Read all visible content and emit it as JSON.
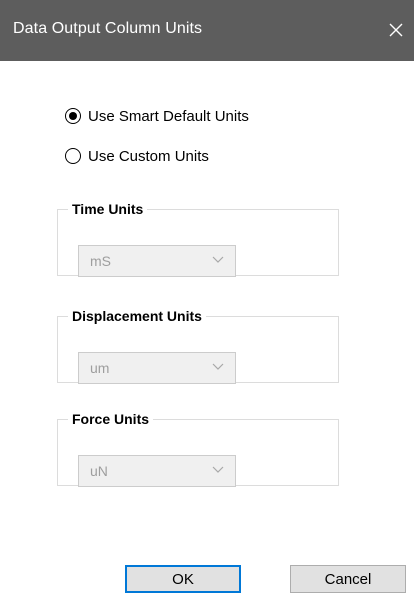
{
  "window": {
    "title": "Data Output Column Units",
    "close_icon": "close-icon"
  },
  "units_mode": {
    "options": [
      {
        "label": "Use Smart Default Units",
        "selected": true
      },
      {
        "label": "Use Custom Units",
        "selected": false
      }
    ]
  },
  "groups": {
    "time": {
      "title": "Time Units",
      "value": "mS",
      "enabled": false
    },
    "displacement": {
      "title": "Displacement Units",
      "value": "um",
      "enabled": false
    },
    "force": {
      "title": "Force Units",
      "value": "uN",
      "enabled": false
    }
  },
  "buttons": {
    "ok": "OK",
    "cancel": "Cancel"
  },
  "colors": {
    "titlebar": "#5d5d5d",
    "default_button_border": "#0078d7",
    "disabled_text": "#9e9e9e"
  }
}
